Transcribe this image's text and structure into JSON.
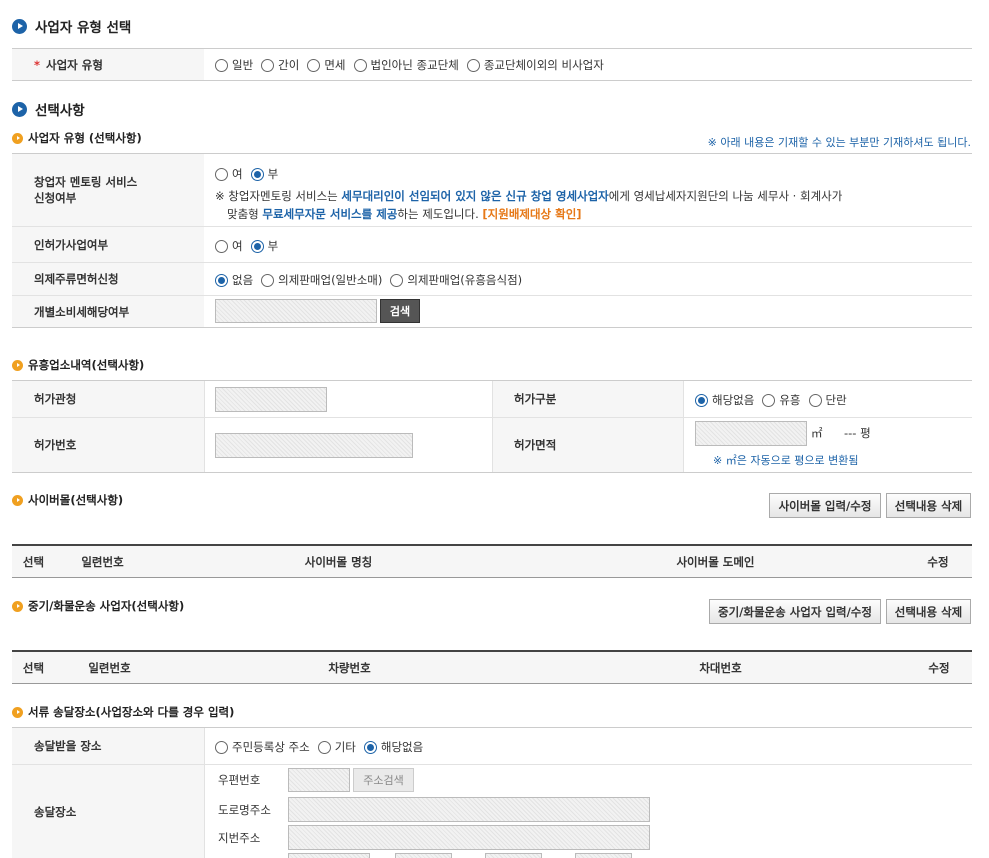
{
  "section1": {
    "title": "사업자 유형 선택",
    "row_label": "사업자 유형",
    "options": [
      "일반",
      "간이",
      "면세",
      "법인아닌 종교단체",
      "종교단체이외의 비사업자"
    ]
  },
  "section2": {
    "title": "선택사항",
    "sub_title": "사업자 유형 (선택사항)",
    "note": "※ 아래 내용은 기재할 수 있는 부분만 기재하셔도 됩니다.",
    "mentor": {
      "label_line1": "창업자 멘토링 서비스",
      "label_line2": "신청여부",
      "opt_yes": "여",
      "opt_no": "부",
      "desc_a": "※ 창업자멘토링 서비스는 ",
      "desc_b": "세무대리인이 선임되어 있지 않은 신규 창업 영세사업자",
      "desc_c": "에게 영세납세자지원단의 나눔 세무사 · 회계사가",
      "desc_d": "맞춤형 ",
      "desc_e": "무료세무자문 서비스를 제공",
      "desc_f": "하는 제도입니다. ",
      "desc_link": "[지원배제대상 확인]"
    },
    "license": {
      "label": "인허가사업여부",
      "opt_yes": "여",
      "opt_no": "부"
    },
    "liquor": {
      "label": "의제주류면허신청",
      "options": [
        "없음",
        "의제판매업(일반소매)",
        "의제판매업(유흥음식점)"
      ]
    },
    "excise": {
      "label": "개별소비세해당여부",
      "search": "검색"
    }
  },
  "entertainment": {
    "title": "유흥업소내역(선택사항)",
    "office_label": "허가관청",
    "type_label": "허가구분",
    "type_options": [
      "해당없음",
      "유흥",
      "단란"
    ],
    "number_label": "허가번호",
    "area_label": "허가면적",
    "area_unit": "㎡",
    "area_pyeong": "--- 평",
    "area_note": "※ ㎡은 자동으로 평으로 변환됨"
  },
  "cyber": {
    "title": "사이버몰(선택사항)",
    "btn_edit": "사이버몰 입력/수정",
    "btn_delete": "선택내용 삭제",
    "columns": [
      "선택",
      "일련번호",
      "사이버몰 명칭",
      "사이버몰 도메인",
      "수정"
    ]
  },
  "freight": {
    "title": "중기/화물운송 사업자(선택사항)",
    "btn_edit": "중기/화물운송 사업자 입력/수정",
    "btn_delete": "선택내용 삭제",
    "columns": [
      "선택",
      "일련번호",
      "차량번호",
      "차대번호",
      "수정"
    ]
  },
  "delivery": {
    "title": "서류 송달장소(사업장소와 다를 경우 입력)",
    "place_label": "송달받을 장소",
    "place_options": [
      "주민등록상 주소",
      "기타",
      "해당없음"
    ],
    "addr_label": "송달장소",
    "zip_label": "우편번호",
    "zip_btn": "주소검색",
    "road_label": "도로명주소",
    "lot_label": "지번주소"
  }
}
